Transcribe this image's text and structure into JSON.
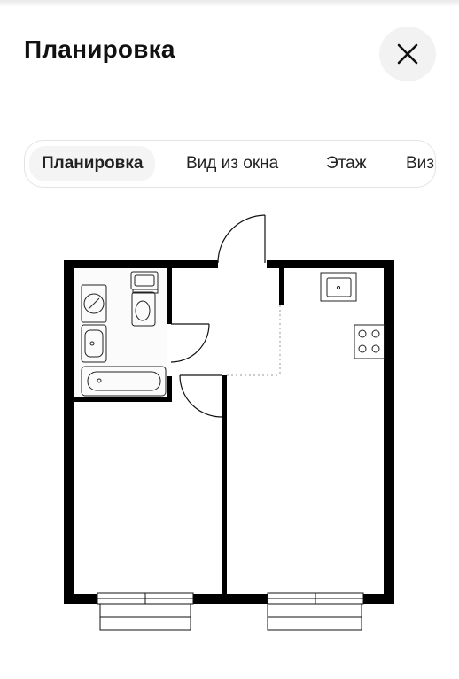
{
  "header": {
    "title": "Планировка"
  },
  "close_button": {
    "icon": "close-icon"
  },
  "tabs": [
    {
      "label": "Планировка",
      "active": true
    },
    {
      "label": "Вид из окна",
      "active": false
    },
    {
      "label": "Этаж",
      "active": false
    },
    {
      "label": "Виз",
      "active": false
    }
  ],
  "floor_plan": {
    "type": "one-room apartment layout"
  }
}
